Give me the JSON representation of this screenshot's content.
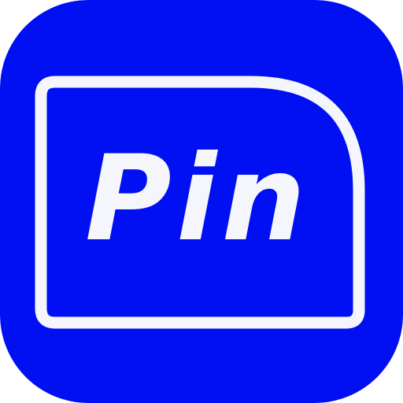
{
  "app_icon": {
    "logo_text": "Pin",
    "icon_name": "pin-app-logo-icon",
    "colors": {
      "background": "#0010f2",
      "frame_stroke": "#f4f6fb",
      "text": "#f4f6fb"
    }
  }
}
